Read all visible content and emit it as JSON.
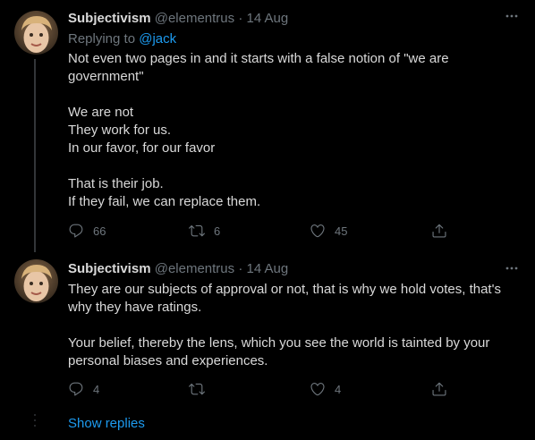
{
  "colors": {
    "background": "#000000",
    "text": "#d9d9d9",
    "muted": "#6e767d",
    "accent": "#1d9bf0",
    "thread_line": "#333639"
  },
  "tweets": [
    {
      "name": "Subjectivism",
      "handle": "@elementrus",
      "dot": "·",
      "date": "14 Aug",
      "more_icon": "more-horizontal-icon",
      "replying_prefix": "Replying to",
      "replying_to": "@jack",
      "lines": [
        "Not even two pages in and it starts with a false notion of \"we are",
        "government\"",
        "",
        "We are not",
        "They work for us.",
        "In our favor, for our favor",
        "",
        "That is their job.",
        "If they fail, we can replace them."
      ],
      "reply_count": "66",
      "retweet_count": "6",
      "like_count": "45"
    },
    {
      "name": "Subjectivism",
      "handle": "@elementrus",
      "dot": "·",
      "date": "14 Aug",
      "more_icon": "more-horizontal-icon",
      "lines": [
        "They are our subjects of approval or not, that is why we hold votes, that's",
        "why they have ratings.",
        "",
        "Your belief, thereby the lens, which you see the world is tainted by your",
        "personal biases and experiences."
      ],
      "reply_count": "4",
      "retweet_count": "",
      "like_count": "4"
    }
  ],
  "show_replies_label": "Show replies"
}
